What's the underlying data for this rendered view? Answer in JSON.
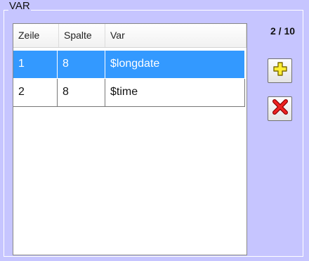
{
  "group": {
    "title": "VAR"
  },
  "counter": "2 / 10",
  "table": {
    "columns": [
      "Zeile",
      "Spalte",
      "Var"
    ],
    "rows": [
      {
        "zeile": "1",
        "spalte": "8",
        "var": "$longdate",
        "selected": true
      },
      {
        "zeile": "2",
        "spalte": "8",
        "var": "$time",
        "selected": false
      }
    ]
  },
  "buttons": {
    "add": {
      "icon": "plus-icon",
      "color": "#ffee33"
    },
    "delete": {
      "icon": "close-icon",
      "color": "#ee2222"
    }
  },
  "colors": {
    "background": "#c6c5ff",
    "selection": "#3399ff"
  }
}
